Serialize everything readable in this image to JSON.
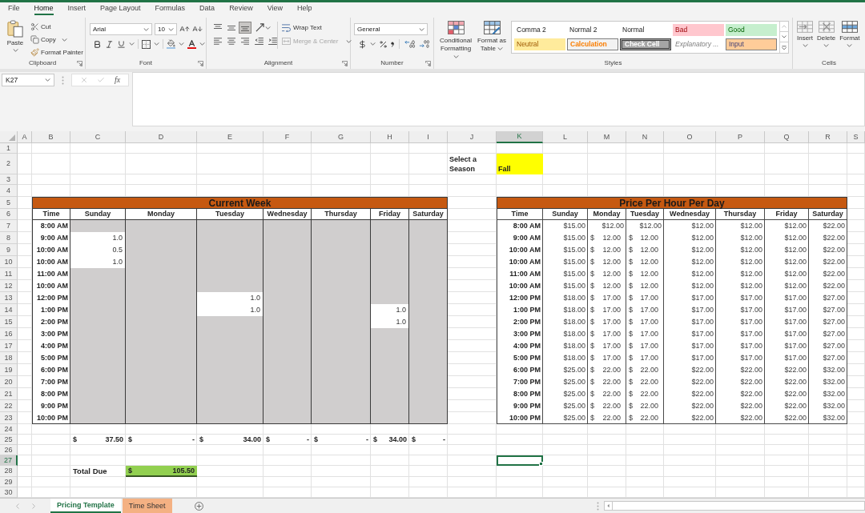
{
  "menu_tabs": [
    {
      "label": "File",
      "selected": false
    },
    {
      "label": "Home",
      "selected": true
    },
    {
      "label": "Insert",
      "selected": false
    },
    {
      "label": "Page Layout",
      "selected": false
    },
    {
      "label": "Formulas",
      "selected": false
    },
    {
      "label": "Data",
      "selected": false
    },
    {
      "label": "Review",
      "selected": false
    },
    {
      "label": "View",
      "selected": false
    },
    {
      "label": "Help",
      "selected": false
    }
  ],
  "ribbon": {
    "clipboard": {
      "label": "Clipboard",
      "paste": "Paste",
      "cut": "Cut",
      "copy": "Copy",
      "format_painter": "Format Painter"
    },
    "font": {
      "label": "Font",
      "font_name": "Arial",
      "font_size": "10"
    },
    "alignment": {
      "label": "Alignment",
      "vertical_align": [
        {
          "kind": "top",
          "selected": false
        },
        {
          "kind": "middle",
          "selected": false
        },
        {
          "kind": "bottom",
          "selected": true
        }
      ],
      "horizontal_align": [
        {
          "kind": "left",
          "selected": false
        },
        {
          "kind": "center",
          "selected": false
        },
        {
          "kind": "right",
          "selected": false
        }
      ],
      "wrap_text": "Wrap Text",
      "merge_center": {
        "label": "Merge & Center",
        "disabled": true
      }
    },
    "number": {
      "label": "Number",
      "format": "General"
    },
    "styles": {
      "label": "Styles",
      "conditional_formatting": "Conditional Formatting",
      "format_as_table": "Format as Table",
      "gallery": [
        {
          "label": "Comma 2",
          "kind": "plain"
        },
        {
          "label": "Normal 2",
          "kind": "plain"
        },
        {
          "label": "Normal",
          "kind": "plain"
        },
        {
          "label": "Bad",
          "kind": "bad"
        },
        {
          "label": "Good",
          "kind": "good"
        },
        {
          "label": "Neutral",
          "kind": "neutral"
        },
        {
          "label": "Calculation",
          "kind": "calculation"
        },
        {
          "label": "Check Cell",
          "kind": "check"
        },
        {
          "label": "Explanatory ...",
          "kind": "explanatory"
        },
        {
          "label": "Input",
          "kind": "input"
        }
      ]
    },
    "cells": {
      "label": "Cells",
      "buttons": [
        {
          "label": "Insert",
          "kind": "insert"
        },
        {
          "label": "Delete",
          "kind": "delete"
        },
        {
          "label": "Format",
          "kind": "format"
        }
      ]
    }
  },
  "formula_bar": {
    "name_box": "K27",
    "function_button": "fx"
  },
  "sheet": {
    "columns": [
      {
        "label": "A",
        "selected": false
      },
      {
        "label": "B",
        "selected": false
      },
      {
        "label": "C",
        "selected": false
      },
      {
        "label": "D",
        "selected": false
      },
      {
        "label": "E",
        "selected": false
      },
      {
        "label": "F",
        "selected": false
      },
      {
        "label": "G",
        "selected": false
      },
      {
        "label": "H",
        "selected": false
      },
      {
        "label": "I",
        "selected": false
      },
      {
        "label": "J",
        "selected": false
      },
      {
        "label": "K",
        "selected": true
      },
      {
        "label": "L",
        "selected": false
      },
      {
        "label": "M",
        "selected": false
      },
      {
        "label": "N",
        "selected": false
      },
      {
        "label": "O",
        "selected": false
      },
      {
        "label": "P",
        "selected": false
      },
      {
        "label": "Q",
        "selected": false
      },
      {
        "label": "R",
        "selected": false
      },
      {
        "label": "S",
        "selected": false
      }
    ],
    "rows": [
      {
        "label": "1",
        "selected": false
      },
      {
        "label": "2",
        "selected": false
      },
      {
        "label": "3",
        "selected": false
      },
      {
        "label": "4",
        "selected": false
      },
      {
        "label": "5",
        "selected": false
      },
      {
        "label": "6",
        "selected": false
      },
      {
        "label": "7",
        "selected": false
      },
      {
        "label": "8",
        "selected": false
      },
      {
        "label": "9",
        "selected": false
      },
      {
        "label": "10",
        "selected": false
      },
      {
        "label": "11",
        "selected": false
      },
      {
        "label": "12",
        "selected": false
      },
      {
        "label": "13",
        "selected": false
      },
      {
        "label": "14",
        "selected": false
      },
      {
        "label": "15",
        "selected": false
      },
      {
        "label": "16",
        "selected": false
      },
      {
        "label": "17",
        "selected": false
      },
      {
        "label": "18",
        "selected": false
      },
      {
        "label": "19",
        "selected": false
      },
      {
        "label": "20",
        "selected": false
      },
      {
        "label": "21",
        "selected": false
      },
      {
        "label": "22",
        "selected": false
      },
      {
        "label": "23",
        "selected": false
      },
      {
        "label": "24",
        "selected": false
      },
      {
        "label": "25",
        "selected": false
      },
      {
        "label": "26",
        "selected": false
      },
      {
        "label": "27",
        "selected": true
      },
      {
        "label": "28",
        "selected": false
      },
      {
        "label": "29",
        "selected": false
      },
      {
        "label": "30",
        "selected": false
      }
    ],
    "season_selector": {
      "label": "Select a Season",
      "value": "Fall"
    },
    "current_week": {
      "title": "Current Week",
      "columns": [
        "Time",
        "Sunday",
        "Monday",
        "Tuesday",
        "Wednesday",
        "Thursday",
        "Friday",
        "Saturday"
      ],
      "rows": [
        {
          "time": "8:00 AM",
          "cells": [
            {
              "shaded": true
            },
            {
              "shaded": true
            },
            {
              "shaded": true
            },
            {
              "shaded": true
            },
            {
              "shaded": true
            },
            {
              "shaded": true
            },
            {
              "shaded": true
            }
          ]
        },
        {
          "time": "9:00 AM",
          "cells": [
            {
              "shaded": false,
              "value": "1.0"
            },
            {
              "shaded": true
            },
            {
              "shaded": true
            },
            {
              "shaded": true
            },
            {
              "shaded": true
            },
            {
              "shaded": true
            },
            {
              "shaded": true
            }
          ]
        },
        {
          "time": "10:00 AM",
          "cells": [
            {
              "shaded": false,
              "value": "0.5"
            },
            {
              "shaded": true
            },
            {
              "shaded": true
            },
            {
              "shaded": true
            },
            {
              "shaded": true
            },
            {
              "shaded": true
            },
            {
              "shaded": true
            }
          ]
        },
        {
          "time": "10:00 AM",
          "cells": [
            {
              "shaded": false,
              "value": "1.0"
            },
            {
              "shaded": true
            },
            {
              "shaded": true
            },
            {
              "shaded": true
            },
            {
              "shaded": true
            },
            {
              "shaded": true
            },
            {
              "shaded": true
            }
          ]
        },
        {
          "time": "11:00 AM",
          "cells": [
            {
              "shaded": true
            },
            {
              "shaded": true
            },
            {
              "shaded": true
            },
            {
              "shaded": true
            },
            {
              "shaded": true
            },
            {
              "shaded": true
            },
            {
              "shaded": true
            }
          ]
        },
        {
          "time": "10:00 AM",
          "cells": [
            {
              "shaded": true
            },
            {
              "shaded": true
            },
            {
              "shaded": true
            },
            {
              "shaded": true
            },
            {
              "shaded": true
            },
            {
              "shaded": true
            },
            {
              "shaded": true
            }
          ]
        },
        {
          "time": "12:00 PM",
          "cells": [
            {
              "shaded": true
            },
            {
              "shaded": true
            },
            {
              "shaded": false,
              "value": "1.0"
            },
            {
              "shaded": true
            },
            {
              "shaded": true
            },
            {
              "shaded": true
            },
            {
              "shaded": true
            }
          ]
        },
        {
          "time": "1:00 PM",
          "cells": [
            {
              "shaded": true
            },
            {
              "shaded": true
            },
            {
              "shaded": false,
              "value": "1.0"
            },
            {
              "shaded": true
            },
            {
              "shaded": true
            },
            {
              "shaded": false,
              "value": "1.0"
            },
            {
              "shaded": true
            }
          ]
        },
        {
          "time": "2:00 PM",
          "cells": [
            {
              "shaded": true
            },
            {
              "shaded": true
            },
            {
              "shaded": true
            },
            {
              "shaded": true
            },
            {
              "shaded": true
            },
            {
              "shaded": false,
              "value": "1.0"
            },
            {
              "shaded": true
            }
          ]
        },
        {
          "time": "3:00 PM",
          "cells": [
            {
              "shaded": true
            },
            {
              "shaded": true
            },
            {
              "shaded": true
            },
            {
              "shaded": true
            },
            {
              "shaded": true
            },
            {
              "shaded": true
            },
            {
              "shaded": true
            }
          ]
        },
        {
          "time": "4:00 PM",
          "cells": [
            {
              "shaded": true
            },
            {
              "shaded": true
            },
            {
              "shaded": true
            },
            {
              "shaded": true
            },
            {
              "shaded": true
            },
            {
              "shaded": true
            },
            {
              "shaded": true
            }
          ]
        },
        {
          "time": "5:00 PM",
          "cells": [
            {
              "shaded": true
            },
            {
              "shaded": true
            },
            {
              "shaded": true
            },
            {
              "shaded": true
            },
            {
              "shaded": true
            },
            {
              "shaded": true
            },
            {
              "shaded": true
            }
          ]
        },
        {
          "time": "6:00 PM",
          "cells": [
            {
              "shaded": true
            },
            {
              "shaded": true
            },
            {
              "shaded": true
            },
            {
              "shaded": true
            },
            {
              "shaded": true
            },
            {
              "shaded": true
            },
            {
              "shaded": true
            }
          ]
        },
        {
          "time": "7:00 PM",
          "cells": [
            {
              "shaded": true
            },
            {
              "shaded": true
            },
            {
              "shaded": true
            },
            {
              "shaded": true
            },
            {
              "shaded": true
            },
            {
              "shaded": true
            },
            {
              "shaded": true
            }
          ]
        },
        {
          "time": "8:00 PM",
          "cells": [
            {
              "shaded": true
            },
            {
              "shaded": true
            },
            {
              "shaded": true
            },
            {
              "shaded": true
            },
            {
              "shaded": true
            },
            {
              "shaded": true
            },
            {
              "shaded": true
            }
          ]
        },
        {
          "time": "9:00 PM",
          "cells": [
            {
              "shaded": true
            },
            {
              "shaded": true
            },
            {
              "shaded": true
            },
            {
              "shaded": true
            },
            {
              "shaded": true
            },
            {
              "shaded": true
            },
            {
              "shaded": true
            }
          ]
        },
        {
          "time": "10:00 PM",
          "cells": [
            {
              "shaded": true
            },
            {
              "shaded": true
            },
            {
              "shaded": true
            },
            {
              "shaded": true
            },
            {
              "shaded": true
            },
            {
              "shaded": true
            },
            {
              "shaded": true
            }
          ]
        }
      ]
    },
    "daily_totals": [
      {
        "symbol": "$",
        "amount": "37.50"
      },
      {
        "symbol": "$",
        "amount": "-"
      },
      {
        "symbol": "$",
        "amount": "34.00"
      },
      {
        "symbol": "$",
        "amount": "-"
      },
      {
        "symbol": "$",
        "amount": "-"
      },
      {
        "symbol": "$",
        "amount": "34.00"
      },
      {
        "symbol": "$",
        "amount": "-"
      }
    ],
    "total_due": {
      "label": "Total Due",
      "symbol": "$",
      "amount": "105.50"
    },
    "price_table": {
      "title": "Price Per Hour Per Day",
      "columns": [
        "Time",
        "Sunday",
        "Monday",
        "Tuesday",
        "Wednesday",
        "Thursday",
        "Friday",
        "Saturday"
      ],
      "rows": [
        {
          "time": "8:00 AM",
          "prices": [
            {
              "kind": "currency",
              "text": "$15.00"
            },
            {
              "kind": "currency",
              "text": "$12.00"
            },
            {
              "kind": "currency",
              "text": "$12.00"
            },
            {
              "kind": "currency",
              "text": "$12.00"
            },
            {
              "kind": "currency",
              "text": "$12.00"
            },
            {
              "kind": "currency",
              "text": "$12.00"
            },
            {
              "kind": "currency",
              "text": "$22.00"
            }
          ]
        },
        {
          "time": "9:00 AM",
          "prices": [
            {
              "kind": "currency",
              "text": "$15.00"
            },
            {
              "kind": "accounting",
              "symbol": "$",
              "amount": "12.00"
            },
            {
              "kind": "accounting",
              "symbol": "$",
              "amount": "12.00"
            },
            {
              "kind": "currency",
              "text": "$12.00"
            },
            {
              "kind": "currency",
              "text": "$12.00"
            },
            {
              "kind": "currency",
              "text": "$12.00"
            },
            {
              "kind": "currency",
              "text": "$22.00"
            }
          ]
        },
        {
          "time": "10:00 AM",
          "prices": [
            {
              "kind": "currency",
              "text": "$15.00"
            },
            {
              "kind": "accounting",
              "symbol": "$",
              "amount": "12.00"
            },
            {
              "kind": "accounting",
              "symbol": "$",
              "amount": "12.00"
            },
            {
              "kind": "currency",
              "text": "$12.00"
            },
            {
              "kind": "currency",
              "text": "$12.00"
            },
            {
              "kind": "currency",
              "text": "$12.00"
            },
            {
              "kind": "currency",
              "text": "$22.00"
            }
          ]
        },
        {
          "time": "10:00 AM",
          "prices": [
            {
              "kind": "currency",
              "text": "$15.00"
            },
            {
              "kind": "accounting",
              "symbol": "$",
              "amount": "12.00"
            },
            {
              "kind": "accounting",
              "symbol": "$",
              "amount": "12.00"
            },
            {
              "kind": "currency",
              "text": "$12.00"
            },
            {
              "kind": "currency",
              "text": "$12.00"
            },
            {
              "kind": "currency",
              "text": "$12.00"
            },
            {
              "kind": "currency",
              "text": "$22.00"
            }
          ]
        },
        {
          "time": "11:00 AM",
          "prices": [
            {
              "kind": "currency",
              "text": "$15.00"
            },
            {
              "kind": "accounting",
              "symbol": "$",
              "amount": "12.00"
            },
            {
              "kind": "accounting",
              "symbol": "$",
              "amount": "12.00"
            },
            {
              "kind": "currency",
              "text": "$12.00"
            },
            {
              "kind": "currency",
              "text": "$12.00"
            },
            {
              "kind": "currency",
              "text": "$12.00"
            },
            {
              "kind": "currency",
              "text": "$22.00"
            }
          ]
        },
        {
          "time": "10:00 AM",
          "prices": [
            {
              "kind": "currency",
              "text": "$15.00"
            },
            {
              "kind": "accounting",
              "symbol": "$",
              "amount": "12.00"
            },
            {
              "kind": "accounting",
              "symbol": "$",
              "amount": "12.00"
            },
            {
              "kind": "currency",
              "text": "$12.00"
            },
            {
              "kind": "currency",
              "text": "$12.00"
            },
            {
              "kind": "currency",
              "text": "$12.00"
            },
            {
              "kind": "currency",
              "text": "$22.00"
            }
          ]
        },
        {
          "time": "12:00 PM",
          "prices": [
            {
              "kind": "currency",
              "text": "$18.00"
            },
            {
              "kind": "accounting",
              "symbol": "$",
              "amount": "17.00"
            },
            {
              "kind": "accounting",
              "symbol": "$",
              "amount": "17.00"
            },
            {
              "kind": "currency",
              "text": "$17.00"
            },
            {
              "kind": "currency",
              "text": "$17.00"
            },
            {
              "kind": "currency",
              "text": "$17.00"
            },
            {
              "kind": "currency",
              "text": "$27.00"
            }
          ]
        },
        {
          "time": "1:00 PM",
          "prices": [
            {
              "kind": "currency",
              "text": "$18.00"
            },
            {
              "kind": "accounting",
              "symbol": "$",
              "amount": "17.00"
            },
            {
              "kind": "accounting",
              "symbol": "$",
              "amount": "17.00"
            },
            {
              "kind": "currency",
              "text": "$17.00"
            },
            {
              "kind": "currency",
              "text": "$17.00"
            },
            {
              "kind": "currency",
              "text": "$17.00"
            },
            {
              "kind": "currency",
              "text": "$27.00"
            }
          ]
        },
        {
          "time": "2:00 PM",
          "prices": [
            {
              "kind": "currency",
              "text": "$18.00"
            },
            {
              "kind": "accounting",
              "symbol": "$",
              "amount": "17.00"
            },
            {
              "kind": "accounting",
              "symbol": "$",
              "amount": "17.00"
            },
            {
              "kind": "currency",
              "text": "$17.00"
            },
            {
              "kind": "currency",
              "text": "$17.00"
            },
            {
              "kind": "currency",
              "text": "$17.00"
            },
            {
              "kind": "currency",
              "text": "$27.00"
            }
          ]
        },
        {
          "time": "3:00 PM",
          "prices": [
            {
              "kind": "currency",
              "text": "$18.00"
            },
            {
              "kind": "accounting",
              "symbol": "$",
              "amount": "17.00"
            },
            {
              "kind": "accounting",
              "symbol": "$",
              "amount": "17.00"
            },
            {
              "kind": "currency",
              "text": "$17.00"
            },
            {
              "kind": "currency",
              "text": "$17.00"
            },
            {
              "kind": "currency",
              "text": "$17.00"
            },
            {
              "kind": "currency",
              "text": "$27.00"
            }
          ]
        },
        {
          "time": "4:00 PM",
          "prices": [
            {
              "kind": "currency",
              "text": "$18.00"
            },
            {
              "kind": "accounting",
              "symbol": "$",
              "amount": "17.00"
            },
            {
              "kind": "accounting",
              "symbol": "$",
              "amount": "17.00"
            },
            {
              "kind": "currency",
              "text": "$17.00"
            },
            {
              "kind": "currency",
              "text": "$17.00"
            },
            {
              "kind": "currency",
              "text": "$17.00"
            },
            {
              "kind": "currency",
              "text": "$27.00"
            }
          ]
        },
        {
          "time": "5:00 PM",
          "prices": [
            {
              "kind": "currency",
              "text": "$18.00"
            },
            {
              "kind": "accounting",
              "symbol": "$",
              "amount": "17.00"
            },
            {
              "kind": "accounting",
              "symbol": "$",
              "amount": "17.00"
            },
            {
              "kind": "currency",
              "text": "$17.00"
            },
            {
              "kind": "currency",
              "text": "$17.00"
            },
            {
              "kind": "currency",
              "text": "$17.00"
            },
            {
              "kind": "currency",
              "text": "$27.00"
            }
          ]
        },
        {
          "time": "6:00 PM",
          "prices": [
            {
              "kind": "currency",
              "text": "$25.00"
            },
            {
              "kind": "accounting",
              "symbol": "$",
              "amount": "22.00"
            },
            {
              "kind": "accounting",
              "symbol": "$",
              "amount": "22.00"
            },
            {
              "kind": "currency",
              "text": "$22.00"
            },
            {
              "kind": "currency",
              "text": "$22.00"
            },
            {
              "kind": "currency",
              "text": "$22.00"
            },
            {
              "kind": "currency",
              "text": "$32.00"
            }
          ]
        },
        {
          "time": "7:00 PM",
          "prices": [
            {
              "kind": "currency",
              "text": "$25.00"
            },
            {
              "kind": "accounting",
              "symbol": "$",
              "amount": "22.00"
            },
            {
              "kind": "accounting",
              "symbol": "$",
              "amount": "22.00"
            },
            {
              "kind": "currency",
              "text": "$22.00"
            },
            {
              "kind": "currency",
              "text": "$22.00"
            },
            {
              "kind": "currency",
              "text": "$22.00"
            },
            {
              "kind": "currency",
              "text": "$32.00"
            }
          ]
        },
        {
          "time": "8:00 PM",
          "prices": [
            {
              "kind": "currency",
              "text": "$25.00"
            },
            {
              "kind": "accounting",
              "symbol": "$",
              "amount": "22.00"
            },
            {
              "kind": "accounting",
              "symbol": "$",
              "amount": "22.00"
            },
            {
              "kind": "currency",
              "text": "$22.00"
            },
            {
              "kind": "currency",
              "text": "$22.00"
            },
            {
              "kind": "currency",
              "text": "$22.00"
            },
            {
              "kind": "currency",
              "text": "$32.00"
            }
          ]
        },
        {
          "time": "9:00 PM",
          "prices": [
            {
              "kind": "currency",
              "text": "$25.00"
            },
            {
              "kind": "accounting",
              "symbol": "$",
              "amount": "22.00"
            },
            {
              "kind": "accounting",
              "symbol": "$",
              "amount": "22.00"
            },
            {
              "kind": "currency",
              "text": "$22.00"
            },
            {
              "kind": "currency",
              "text": "$22.00"
            },
            {
              "kind": "currency",
              "text": "$22.00"
            },
            {
              "kind": "currency",
              "text": "$32.00"
            }
          ]
        },
        {
          "time": "10:00 PM",
          "prices": [
            {
              "kind": "currency",
              "text": "$25.00"
            },
            {
              "kind": "accounting",
              "symbol": "$",
              "amount": "22.00"
            },
            {
              "kind": "accounting",
              "symbol": "$",
              "amount": "22.00"
            },
            {
              "kind": "currency",
              "text": "$22.00"
            },
            {
              "kind": "currency",
              "text": "$22.00"
            },
            {
              "kind": "currency",
              "text": "$22.00"
            },
            {
              "kind": "currency",
              "text": "$32.00"
            }
          ]
        }
      ]
    }
  },
  "sheet_tabs": [
    {
      "label": "Pricing Template",
      "selected": true
    },
    {
      "label": "Time Sheet",
      "selected": false,
      "color": "#f4b183"
    }
  ]
}
